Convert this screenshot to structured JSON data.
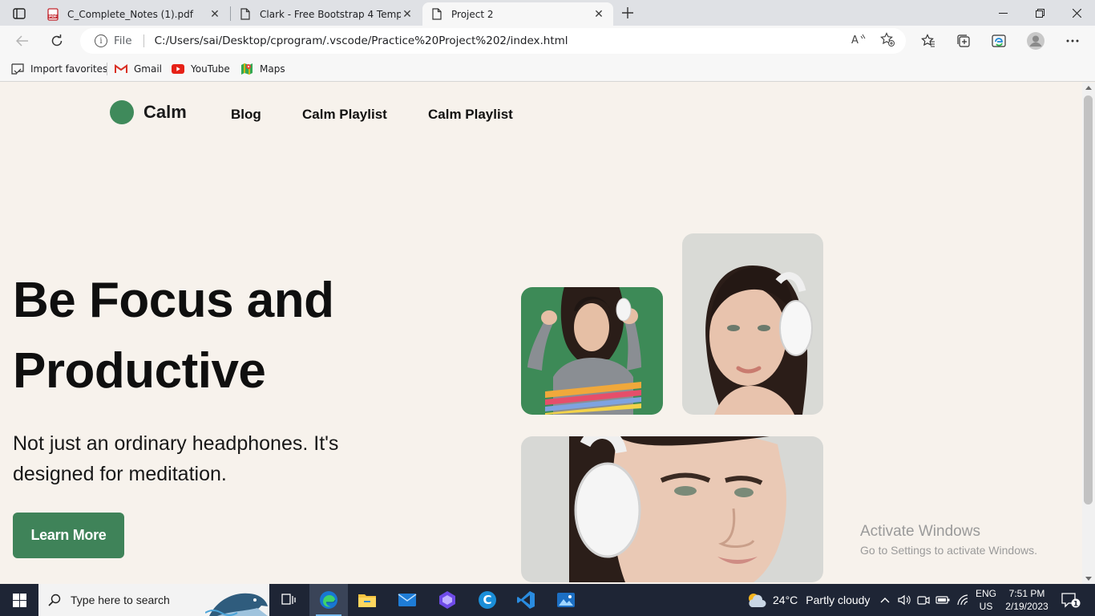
{
  "browser": {
    "tabs": [
      {
        "title": "C_Complete_Notes (1).pdf",
        "icon": "pdf-icon"
      },
      {
        "title": "Clark - Free Bootstrap 4 Template",
        "icon": "page-icon"
      },
      {
        "title": "Project 2",
        "icon": "page-icon",
        "active": true
      }
    ],
    "address": {
      "scheme_label": "File",
      "url": "C:/Users/sai/Desktop/cprogram/.vscode/Practice%20Project%202/index.html"
    },
    "favorites": [
      {
        "label": "Import favorites",
        "icon": "import-icon"
      },
      {
        "label": "Gmail",
        "icon": "gmail-icon"
      },
      {
        "label": "YouTube",
        "icon": "youtube-icon"
      },
      {
        "label": "Maps",
        "icon": "maps-icon"
      }
    ]
  },
  "page": {
    "brand": "Calm",
    "nav": [
      "Blog",
      "Calm Playlist",
      "Calm Playlist"
    ],
    "hero": {
      "title_line1": "Be Focus and",
      "title_line2": "Productive",
      "subtitle": "Not just an ordinary headphones. It's designed for meditation.",
      "cta": "Learn More"
    },
    "accent_color": "#3f8a5b",
    "background_color": "#f7f2ec"
  },
  "watermark": {
    "line1": "Activate Windows",
    "line2": "Go to Settings to activate Windows."
  },
  "taskbar": {
    "search_placeholder": "Type here to search",
    "weather": {
      "temp": "24°C",
      "condition": "Partly cloudy"
    },
    "language": {
      "lang": "ENG",
      "region": "US"
    },
    "clock": {
      "time": "7:51 PM",
      "date": "2/19/2023"
    },
    "notification_count": "1"
  }
}
